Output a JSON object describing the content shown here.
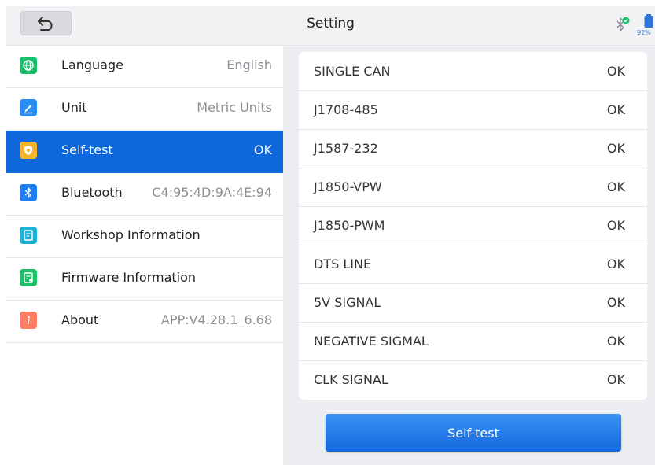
{
  "header": {
    "title": "Setting",
    "battery_percent": "92%",
    "back_icon": "back-arrow-icon",
    "bluetooth_icon": "bluetooth-connected-icon",
    "battery_icon": "battery-icon"
  },
  "sidebar": {
    "items": [
      {
        "label": "Language",
        "value": "English",
        "icon": "globe-icon",
        "color": "#1bbf6b"
      },
      {
        "label": "Unit",
        "value": "Metric Units",
        "icon": "pencil-icon",
        "color": "#2a8ef0"
      },
      {
        "label": "Self-test",
        "value": "OK",
        "icon": "shield-icon",
        "color": "#f5b22b",
        "active": true
      },
      {
        "label": "Bluetooth",
        "value": "C4:95:4D:9A:4E:94",
        "icon": "bluetooth-icon",
        "color": "#1f7ff0"
      },
      {
        "label": "Workshop Information",
        "value": "",
        "icon": "document-icon",
        "color": "#1eb3d8"
      },
      {
        "label": "Firmware Information",
        "value": "",
        "icon": "firmware-doc-icon",
        "color": "#1fbf6a"
      },
      {
        "label": "About",
        "value": "APP:V4.28.1_6.68",
        "icon": "info-icon",
        "color": "#fb7d63"
      }
    ]
  },
  "results": [
    {
      "name": "SINGLE CAN",
      "status": "OK"
    },
    {
      "name": "J1708-485",
      "status": "OK"
    },
    {
      "name": "J1587-232",
      "status": "OK"
    },
    {
      "name": "J1850-VPW",
      "status": "OK"
    },
    {
      "name": "J1850-PWM",
      "status": "OK"
    },
    {
      "name": "DTS LINE",
      "status": "OK"
    },
    {
      "name": "5V SIGNAL",
      "status": "OK"
    },
    {
      "name": "NEGATIVE SIGMAL",
      "status": "OK"
    },
    {
      "name": "CLK SIGNAL",
      "status": "OK"
    }
  ],
  "actions": {
    "selftest_label": "Self-test"
  }
}
